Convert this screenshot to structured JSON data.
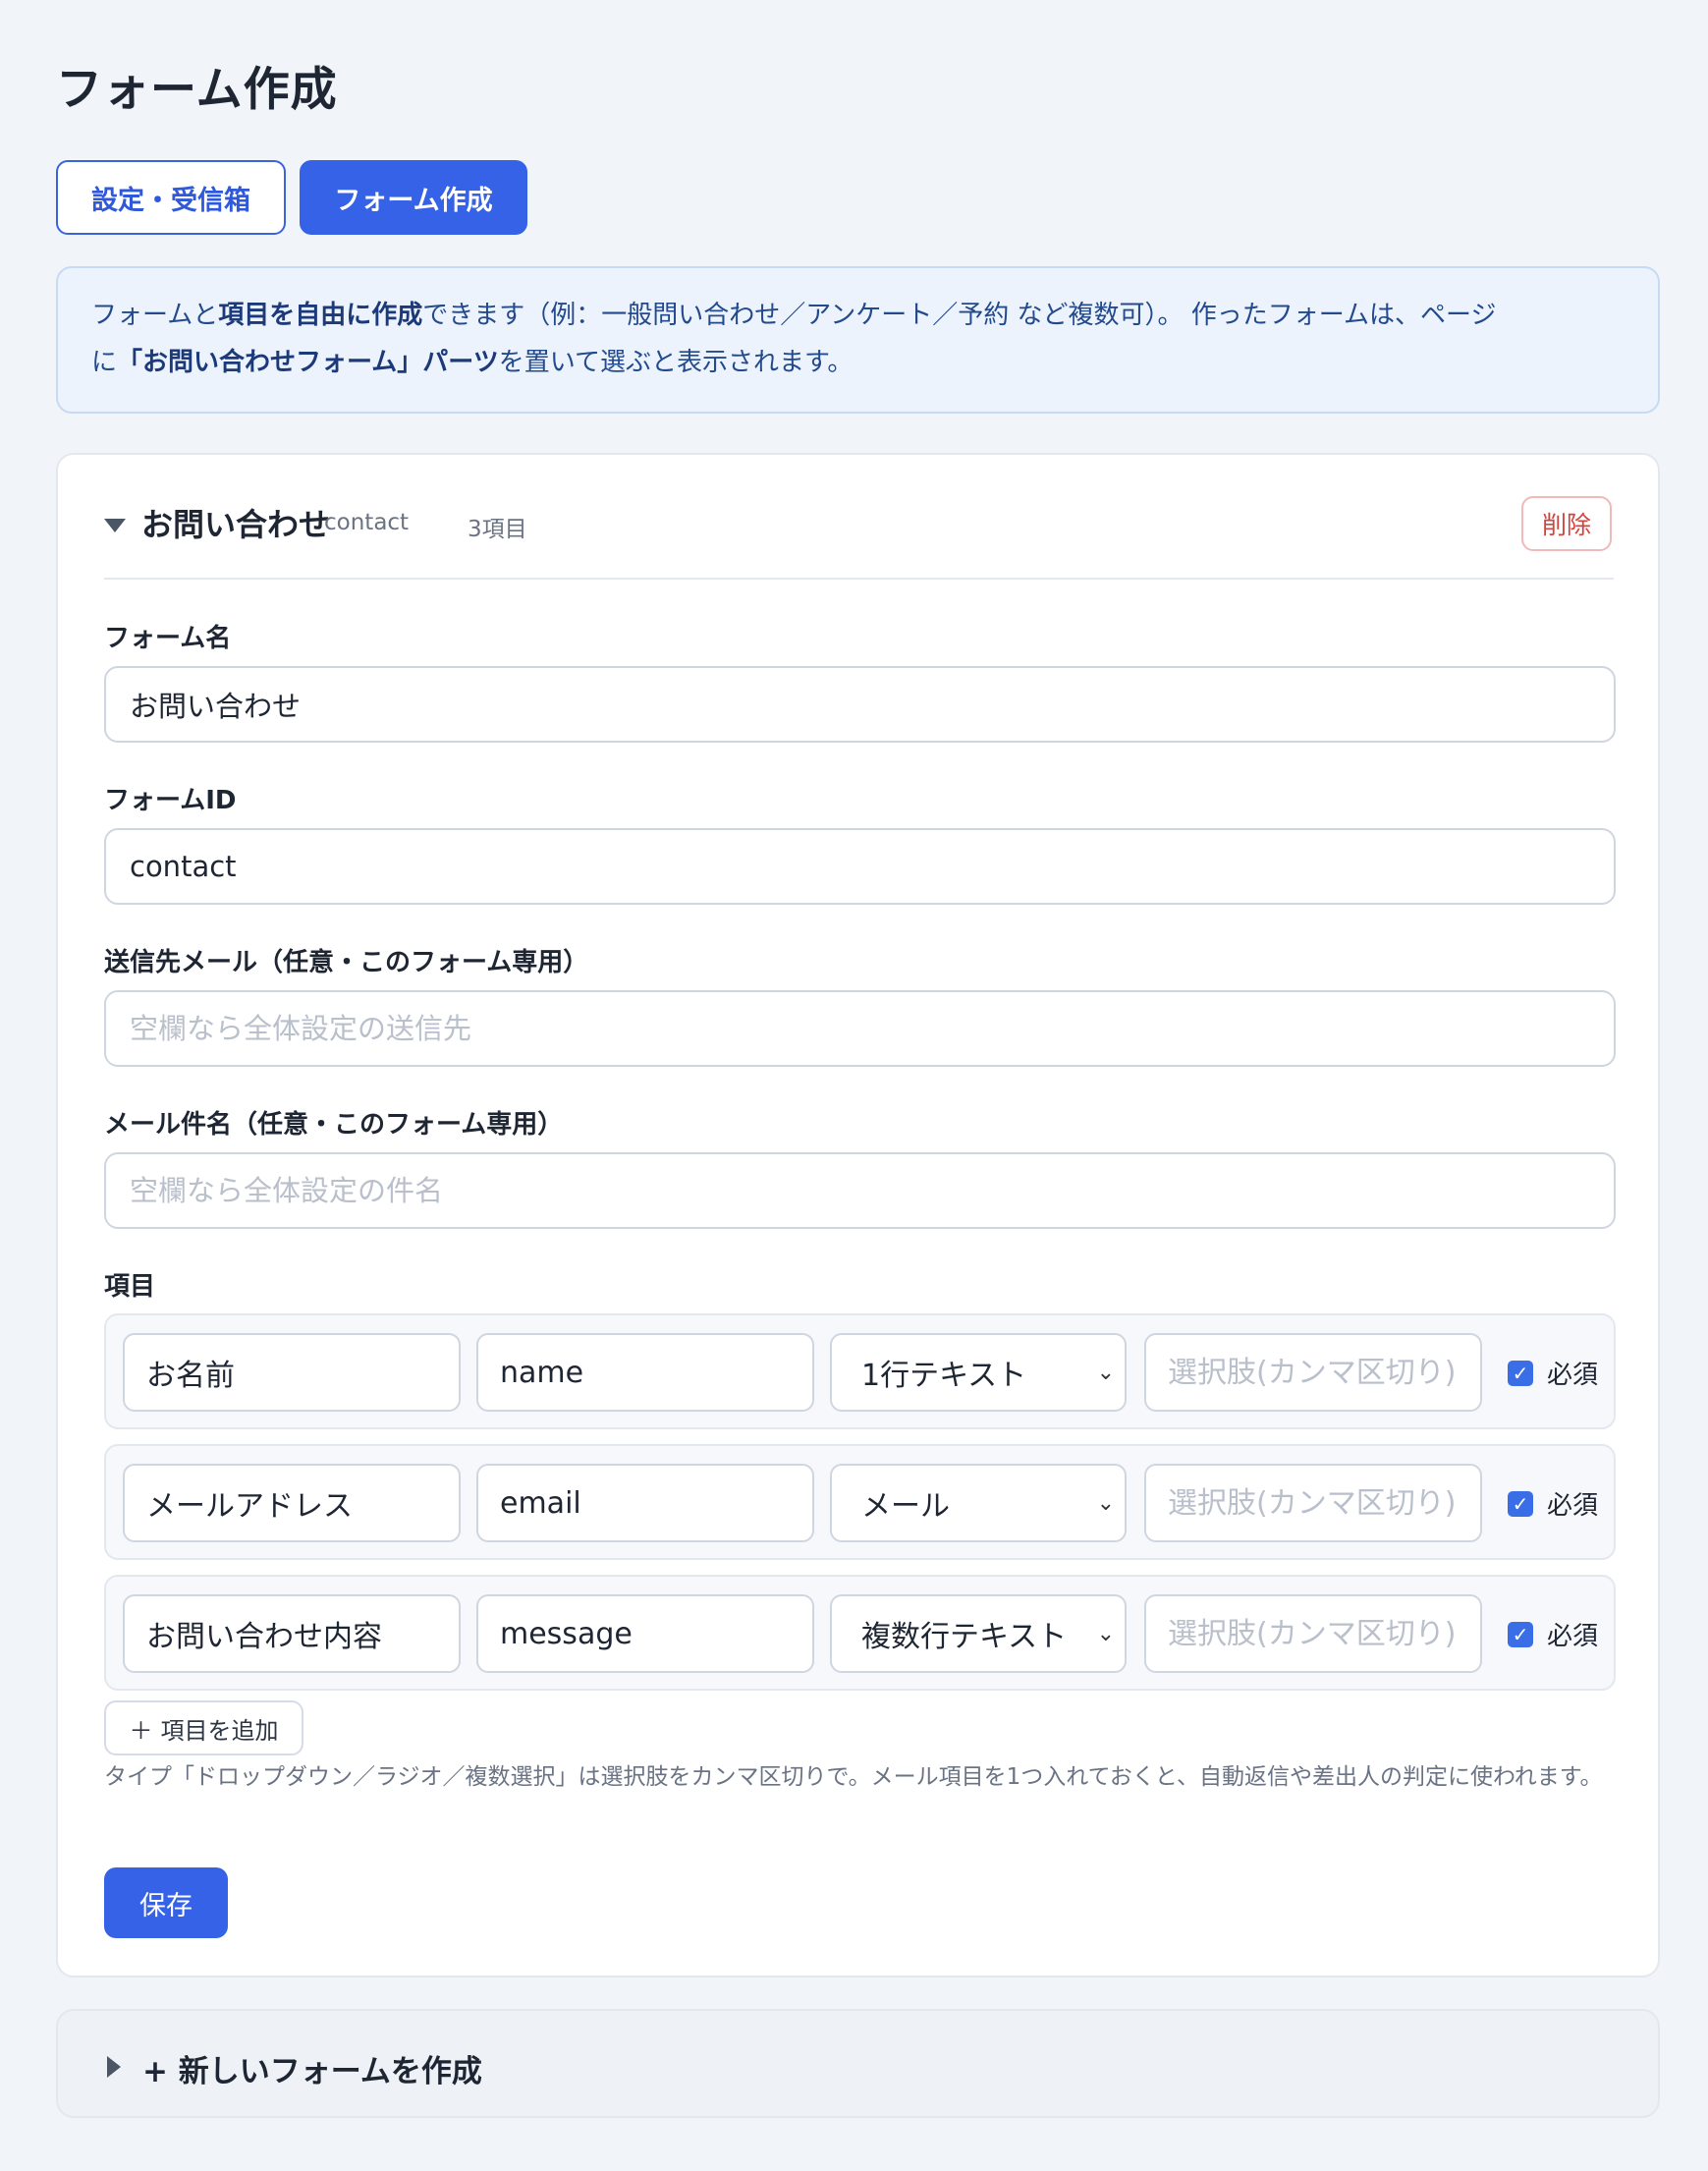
{
  "page": {
    "title": "フォーム作成"
  },
  "tabs": [
    {
      "label": "設定・受信箱",
      "active": false
    },
    {
      "label": "フォーム作成",
      "active": true
    }
  ],
  "info": {
    "line1_pre": "フォームと",
    "line1_bold": "項目を自由に作成",
    "line1_post": "できます（例：一般問い合わせ／アンケート／予約 など複数可）。 作ったフォームは、ページ",
    "line2_pre": "に",
    "line2_bold": "「お問い合わせフォーム」パーツ",
    "line2_post": "を置いて選ぶと表示されます。"
  },
  "form_card": {
    "title": "お問い合わせ",
    "slug": "contact",
    "item_count": "3項目",
    "delete_label": "削除",
    "fields": {
      "form_name_label": "フォーム名",
      "form_name_value": "お問い合わせ",
      "form_id_label": "フォームID",
      "form_id_value": "contact",
      "recipient_label": "送信先メール（任意・このフォーム専用）",
      "recipient_placeholder": "空欄なら全体設定の送信先",
      "subject_label": "メール件名（任意・このフォーム専用）",
      "subject_placeholder": "空欄なら全体設定の件名"
    },
    "items_label": "項目",
    "items": [
      {
        "label": "お名前",
        "key": "name",
        "type": "1行テキスト",
        "options_placeholder": "選択肢(カンマ区切り)",
        "required": true,
        "required_label": "必須"
      },
      {
        "label": "メールアドレス",
        "key": "email",
        "type": "メール",
        "options_placeholder": "選択肢(カンマ区切り)",
        "required": true,
        "required_label": "必須"
      },
      {
        "label": "お問い合わせ内容",
        "key": "message",
        "type": "複数行テキスト",
        "options_placeholder": "選択肢(カンマ区切り)",
        "required": true,
        "required_label": "必須"
      }
    ],
    "add_item_label": "項目を追加",
    "help_text": "タイプ「ドロップダウン／ラジオ／複数選択」は選択肢をカンマ区切りで。メール項目を1つ入れておくと、自動返信や差出人の判定に使われます。",
    "save_label": "保存"
  },
  "new_form": {
    "label": "+ 新しいフォームを作成"
  },
  "colors": {
    "accent": "#3562e6",
    "danger": "#d0453f",
    "info_bg": "#ecf3fd"
  }
}
